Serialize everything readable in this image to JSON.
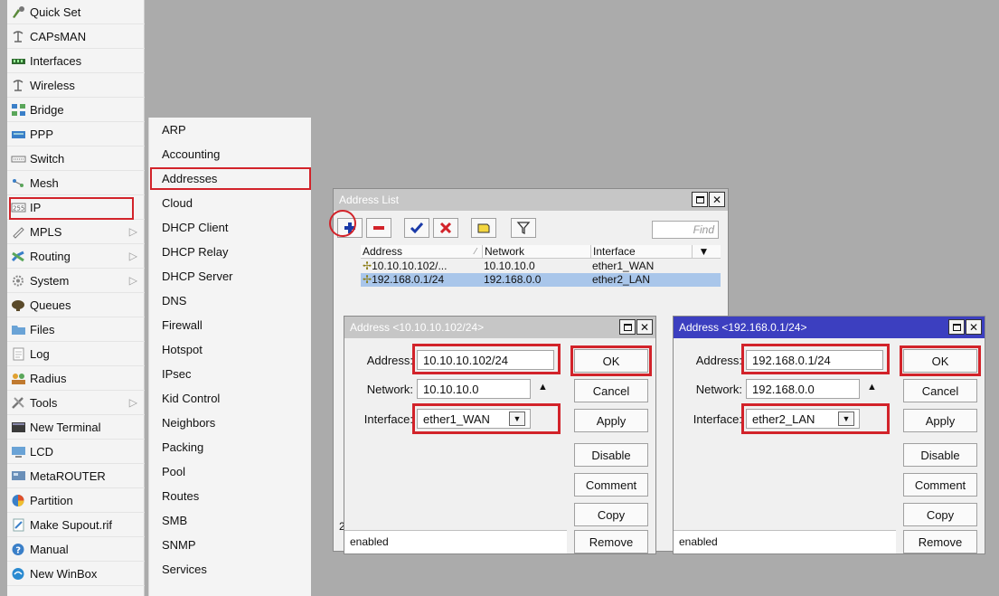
{
  "main_menu": {
    "items": [
      {
        "label": "Quick Set",
        "icon": "quick-set-icon"
      },
      {
        "label": "CAPsMAN",
        "icon": "capsman-icon"
      },
      {
        "label": "Interfaces",
        "icon": "interfaces-icon"
      },
      {
        "label": "Wireless",
        "icon": "wireless-icon"
      },
      {
        "label": "Bridge",
        "icon": "bridge-icon"
      },
      {
        "label": "PPP",
        "icon": "ppp-icon"
      },
      {
        "label": "Switch",
        "icon": "switch-icon"
      },
      {
        "label": "Mesh",
        "icon": "mesh-icon"
      },
      {
        "label": "IP",
        "icon": "ip-icon",
        "selected": true
      },
      {
        "label": "MPLS",
        "icon": "mpls-icon",
        "submenu": true
      },
      {
        "label": "Routing",
        "icon": "routing-icon",
        "submenu": true
      },
      {
        "label": "System",
        "icon": "system-icon",
        "submenu": true
      },
      {
        "label": "Queues",
        "icon": "queues-icon"
      },
      {
        "label": "Files",
        "icon": "files-icon"
      },
      {
        "label": "Log",
        "icon": "log-icon"
      },
      {
        "label": "Radius",
        "icon": "radius-icon"
      },
      {
        "label": "Tools",
        "icon": "tools-icon",
        "submenu": true
      },
      {
        "label": "New Terminal",
        "icon": "terminal-icon"
      },
      {
        "label": "LCD",
        "icon": "lcd-icon"
      },
      {
        "label": "MetaROUTER",
        "icon": "metarouter-icon"
      },
      {
        "label": "Partition",
        "icon": "partition-icon"
      },
      {
        "label": "Make Supout.rif",
        "icon": "supout-icon"
      },
      {
        "label": "Manual",
        "icon": "manual-icon"
      },
      {
        "label": "New WinBox",
        "icon": "winbox-icon"
      }
    ],
    "submenu_arrow": "▷"
  },
  "ip_submenu": {
    "items": [
      "ARP",
      "Accounting",
      "Addresses",
      "Cloud",
      "DHCP Client",
      "DHCP Relay",
      "DHCP Server",
      "DNS",
      "Firewall",
      "Hotspot",
      "IPsec",
      "Kid Control",
      "Neighbors",
      "Packing",
      "Pool",
      "Routes",
      "SMB",
      "SNMP",
      "Services"
    ],
    "selected": "Addresses"
  },
  "address_list": {
    "title": "Address List",
    "find_placeholder": "Find",
    "columns": [
      "Address",
      "Network",
      "Interface"
    ],
    "rows": [
      {
        "address": "10.10.10.102/...",
        "network": "10.10.10.0",
        "interface": "ether1_WAN",
        "highlighted": false
      },
      {
        "address": "192.168.0.1/24",
        "network": "192.168.0.0",
        "interface": "ether2_LAN",
        "highlighted": true
      }
    ],
    "item_count_visible": "2",
    "footer": "enabled"
  },
  "dialog1": {
    "title": "Address <10.10.10.102/24>",
    "address_label": "Address:",
    "address_value": "10.10.10.102/24",
    "network_label": "Network:",
    "network_value": "10.10.10.0",
    "interface_label": "Interface:",
    "interface_value": "ether1_WAN",
    "buttons": [
      "OK",
      "Cancel",
      "Apply",
      "Disable",
      "Comment",
      "Copy",
      "Remove"
    ],
    "status": "enabled",
    "active": false
  },
  "dialog2": {
    "title": "Address <192.168.0.1/24>",
    "address_label": "Address:",
    "address_value": "192.168.0.1/24",
    "network_label": "Network:",
    "network_value": "192.168.0.0",
    "interface_label": "Interface:",
    "interface_value": "ether2_LAN",
    "buttons": [
      "OK",
      "Cancel",
      "Apply",
      "Disable",
      "Comment",
      "Copy",
      "Remove"
    ],
    "status": "enabled",
    "active": true
  },
  "colors": {
    "highlight_red": "#d2232a",
    "active_title": "#3c3fc0",
    "inactive_title": "#c6c6c6",
    "row_selection": "#a9c6ea"
  }
}
